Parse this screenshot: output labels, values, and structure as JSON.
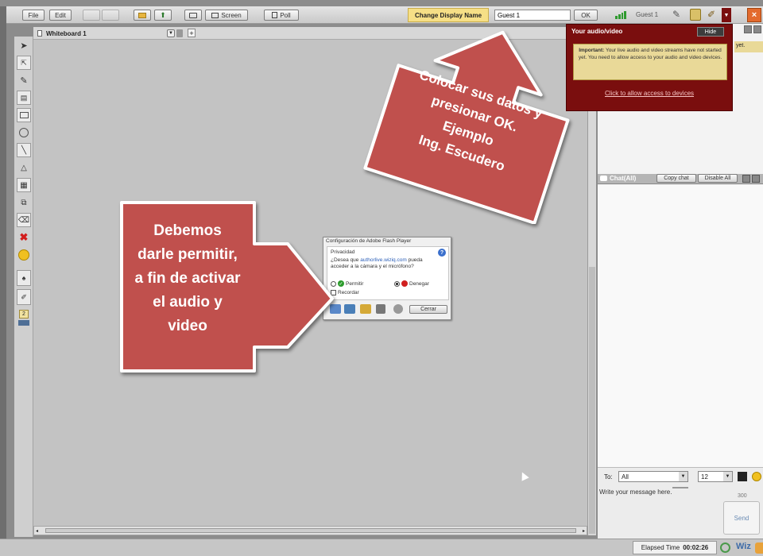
{
  "toolbar": {
    "file": "File",
    "edit": "Edit",
    "screen": "Screen",
    "poll": "Poll",
    "change_display_name": "Change Display Name",
    "display_name_value": "Guest 1",
    "ok": "OK",
    "user_name": "Guest 1",
    "close_glyph": "×"
  },
  "whiteboard": {
    "tab_title": "Whiteboard 1",
    "add_tab": "+",
    "page_number": "2"
  },
  "video_panel": {
    "title": "Your audio/video",
    "hide": "Hide",
    "important_label": "Important:",
    "warning": "Your live audio and video streams have not started yet. You need to allow access to your audio and video devices.",
    "link": "Click to allow access to devices",
    "partial_text": "yet."
  },
  "chat": {
    "title": "Chat(All)",
    "copy": "Copy chat",
    "disable": "Disable All",
    "to_label": "To:",
    "to_value": "All",
    "font_size": "12",
    "message_placeholder": "Write your message here.",
    "char_count": "300",
    "send": "Send"
  },
  "status": {
    "elapsed_label": "Elapsed Time",
    "elapsed_value": "00:02:26",
    "brand": "Wiz"
  },
  "callouts": {
    "top_line1": "Colocar sus datos y",
    "top_line2": "presionar OK.",
    "top_line3": "Ejemplo",
    "top_line4": "Ing. Escudero",
    "left_line1": "Debemos",
    "left_line2": "darle permitir,",
    "left_line3": "a fin de activar",
    "left_line4": "el audio y",
    "left_line5": "video"
  },
  "flash_dialog": {
    "title": "Configuración de Adobe Flash Player",
    "section": "Privacidad",
    "question_pre": "¿Desea que",
    "site": "authorlive.wiziq.com",
    "question_post": "pueda",
    "question_line2": "acceder a la cámara y el micrófono?",
    "allow": "Permitir",
    "deny": "Denegar",
    "remember": "Recordar",
    "close": "Cerrar",
    "allow_checked": false,
    "deny_checked": true,
    "remember_checked": false
  },
  "colors": {
    "callout_fill": "#c0504d",
    "video_panel_bg": "#7a0e0e",
    "warning_bg": "#e9d998",
    "display_name_bg": "#f6df86"
  }
}
